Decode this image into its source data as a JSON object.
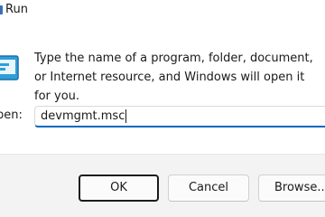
{
  "window": {
    "title": "Run"
  },
  "dialog": {
    "description": "Type the name of a program, folder, document, or Internet resource, and Windows will open it for you.",
    "open_label": "pen:",
    "open_value": "devmgmt.msc"
  },
  "buttons": {
    "ok": "OK",
    "cancel": "Cancel",
    "browse": "Browse..."
  },
  "colors": {
    "accent": "#0067c0",
    "footer_bg": "#f3f3f3"
  },
  "icons": {
    "app": "run-app-icon",
    "dialog": "run-dialog-icon"
  }
}
